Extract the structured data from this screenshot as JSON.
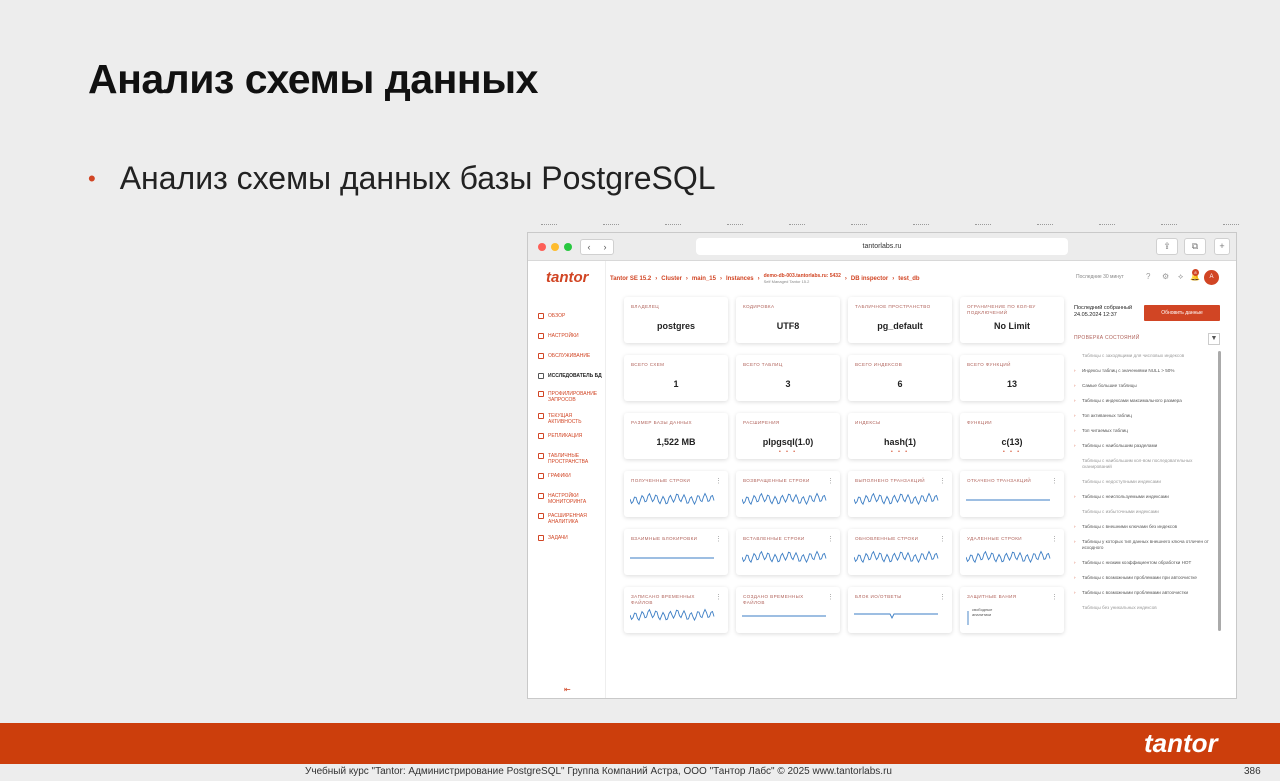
{
  "slide": {
    "title": "Анализ схемы данных",
    "bullet": "Анализ схемы данных базы PostgreSQL"
  },
  "browser": {
    "url": "tantorlabs.ru"
  },
  "app": {
    "logo": "tantor",
    "sidebar": [
      {
        "label": "ОБЗОР",
        "icon": "overview-icon"
      },
      {
        "label": "НАСТРОЙКИ",
        "icon": "settings-icon"
      },
      {
        "label": "ОБСЛУЖИВАНИЕ",
        "icon": "maintenance-icon"
      },
      {
        "label": "ИССЛЕДОВАТЕЛЬ БД",
        "icon": "db-inspector-icon",
        "active": true
      },
      {
        "label": "ПРОФИЛИРОВАНИЕ ЗАПРОСОВ",
        "icon": "profiling-icon"
      },
      {
        "label": "ТЕКУЩАЯ АКТИВНОСТЬ",
        "icon": "activity-icon"
      },
      {
        "label": "РЕПЛИКАЦИЯ",
        "icon": "replication-icon"
      },
      {
        "label": "ТАБЛИЧНЫЕ ПРОСТРАНСТВА",
        "icon": "tablespace-icon"
      },
      {
        "label": "ГРАФИКИ",
        "icon": "charts-icon"
      },
      {
        "label": "НАСТРОЙКИ МОНИТОРИНГА",
        "icon": "monitoring-icon"
      },
      {
        "label": "РАСШИРЕННАЯ АНАЛИТИКА",
        "icon": "analytics-icon"
      },
      {
        "label": "ЗАДАЧИ",
        "icon": "tasks-icon"
      }
    ],
    "breadcrumbs": {
      "version": "Tantor SE 15.2",
      "cluster": "Cluster",
      "main": "main_15",
      "instances": "Instances",
      "host": "demo-db-003.tantorlabs.ru: 5432",
      "host_sub": "Self Managed  Tantor 15.2",
      "inspector": "DB inspector",
      "db": "test_db"
    },
    "period": "Последние 30 минут",
    "notifications": "8",
    "avatar": "A",
    "cards": [
      {
        "label": "ВЛАДЕЛЕЦ",
        "value": "postgres"
      },
      {
        "label": "КОДИРОВКА",
        "value": "UTF8"
      },
      {
        "label": "ТАБЛИЧНОЕ ПРОСТРАНСТВО",
        "value": "pg_default"
      },
      {
        "label": "ОГРАНИЧЕНИЕ ПО КОЛ-ВУ ПОДКЛЮЧЕНИЙ",
        "value": "No Limit"
      },
      {
        "label": "ВСЕГО СХЕМ",
        "value": "1"
      },
      {
        "label": "ВСЕГО ТАБЛИЦ",
        "value": "3"
      },
      {
        "label": "ВСЕГО ИНДЕКСОВ",
        "value": "6"
      },
      {
        "label": "ВСЕГО ФУНКЦИЙ",
        "value": "13"
      },
      {
        "label": "РАЗМЕР БАЗЫ ДАННЫХ",
        "value": "1,522 MB"
      },
      {
        "label": "РАСШИРЕНИЯ",
        "value": "plpgsql(1.0)"
      },
      {
        "label": "ИНДЕКСЫ",
        "value": "hash(1)"
      },
      {
        "label": "ФУНКЦИИ",
        "value": "c(13)"
      }
    ],
    "chart_cards": [
      {
        "label": "ПОЛУЧЕННЫЕ СТРОКИ",
        "kind": "wave"
      },
      {
        "label": "ВОЗВРАЩЕННЫЕ СТРОКИ",
        "kind": "wave"
      },
      {
        "label": "ВЫПОЛНЕНО ТРАНЗАКЦИЙ",
        "kind": "wave"
      },
      {
        "label": "ОТКАЧЕНО ТРАНЗАКЦИЙ",
        "kind": "flat"
      },
      {
        "label": "ВЗАИМНЫЕ БЛОКИРОВКИ",
        "kind": "flat"
      },
      {
        "label": "ВСТАВЛЕННЫЕ СТРОКИ",
        "kind": "wave"
      },
      {
        "label": "ОБНОВЛЕННЫЕ СТРОКИ",
        "kind": "wave"
      },
      {
        "label": "УДАЛЕННЫЕ СТРОКИ",
        "kind": "wave"
      },
      {
        "label": "ЗАПИСАНО ВРЕМЕННЫХ ФАЙЛОВ",
        "kind": "wave"
      },
      {
        "label": "СОЗДАНО ВРЕМЕННЫХ ФАЙЛОВ",
        "kind": "flat"
      },
      {
        "label": "БЛОК ИО/ОТВЕТЫ",
        "kind": "dip"
      },
      {
        "label": "ЗАЩИТНЫЕ ВАНИЯ",
        "kind": "text",
        "note": "свободные аналитики"
      }
    ],
    "right_panel": {
      "last_collected": "Последний собранный\n24.05.2024 12:37",
      "refresh_button": "Обновить данные",
      "health_title": "ПРОВЕРКА СОСТОЯНИЙ",
      "checks": [
        {
          "text": "Таблицы с заходящими для числовых индексов",
          "muted": true
        },
        {
          "text": "Индексы таблиц с значениями NULL > 50%"
        },
        {
          "text": "Самые большие таблицы"
        },
        {
          "text": "Таблицы с индексами максимального размера"
        },
        {
          "text": "Топ активанных таблиц"
        },
        {
          "text": "Топ читаемых таблиц"
        },
        {
          "text": "Таблицы с наибольшим разделами"
        },
        {
          "text": "Таблицы с наибольшим кол-вом последовательных сканирований",
          "muted": true
        },
        {
          "text": "Таблицы с недоступными индексами",
          "muted": true
        },
        {
          "text": "Таблицы с неиспользуемыми индексами"
        },
        {
          "text": "Таблицы с избыточными индексами",
          "muted": true
        },
        {
          "text": "Таблицы с внешними ключами без индексов"
        },
        {
          "text": "Таблицы у которых тип данных внешнего ключа отличен от исходного"
        },
        {
          "text": "Таблицы с низким коэффициентом обработки НОТ"
        },
        {
          "text": "Таблицы с возможными проблемами при автоочистке"
        },
        {
          "text": "Таблицы с возможными проблемами автоочистки"
        },
        {
          "text": "Таблицы без уникальных индексов",
          "muted": true
        }
      ]
    }
  },
  "footer": {
    "text": "Учебный курс \"Tantor: Администрирование PostgreSQL\" Группа Компаний Астра, ООО \"Тантор Лабс\" © 2025  www.tantorlabs.ru",
    "page": "386",
    "logo": "tantor"
  },
  "colors": {
    "accent": "#cc3e0c",
    "brand": "#d14524",
    "chart_line": "#3b7dc4"
  }
}
